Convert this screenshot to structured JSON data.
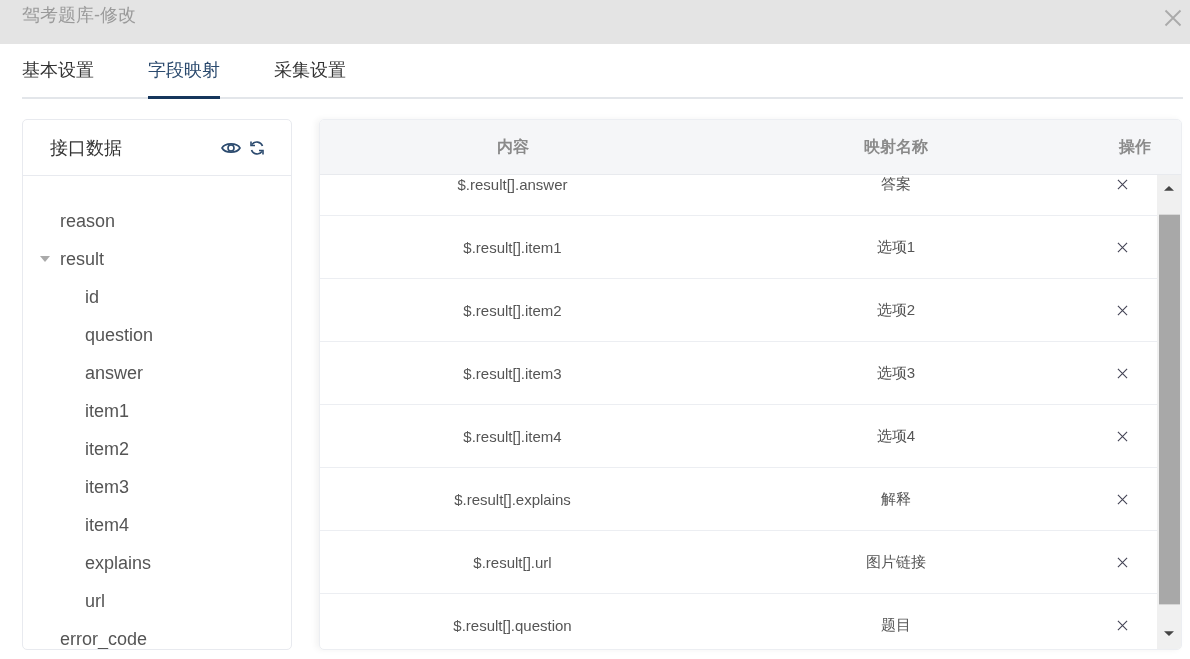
{
  "window": {
    "title": "驾考题库-修改"
  },
  "tabs": [
    {
      "label": "基本设置",
      "selected": false
    },
    {
      "label": "字段映射",
      "selected": true
    },
    {
      "label": "采集设置",
      "selected": false
    }
  ],
  "tree_panel": {
    "title": "接口数据",
    "items": [
      {
        "label": "reason"
      },
      {
        "label": "result",
        "expanded": true,
        "children": [
          {
            "label": "id"
          },
          {
            "label": "question"
          },
          {
            "label": "answer"
          },
          {
            "label": "item1"
          },
          {
            "label": "item2"
          },
          {
            "label": "item3"
          },
          {
            "label": "item4"
          },
          {
            "label": "explains"
          },
          {
            "label": "url"
          }
        ]
      },
      {
        "label": "error_code"
      }
    ]
  },
  "table": {
    "columns": [
      "内容",
      "映射名称",
      "操作"
    ],
    "rows": [
      {
        "content": "$.result[].answer",
        "mapping": "答案"
      },
      {
        "content": "$.result[].item1",
        "mapping": "选项1"
      },
      {
        "content": "$.result[].item2",
        "mapping": "选项2"
      },
      {
        "content": "$.result[].item3",
        "mapping": "选项3"
      },
      {
        "content": "$.result[].item4",
        "mapping": "选项4"
      },
      {
        "content": "$.result[].explains",
        "mapping": "解释"
      },
      {
        "content": "$.result[].url",
        "mapping": "图片链接"
      },
      {
        "content": "$.result[].question",
        "mapping": "题目"
      }
    ]
  }
}
